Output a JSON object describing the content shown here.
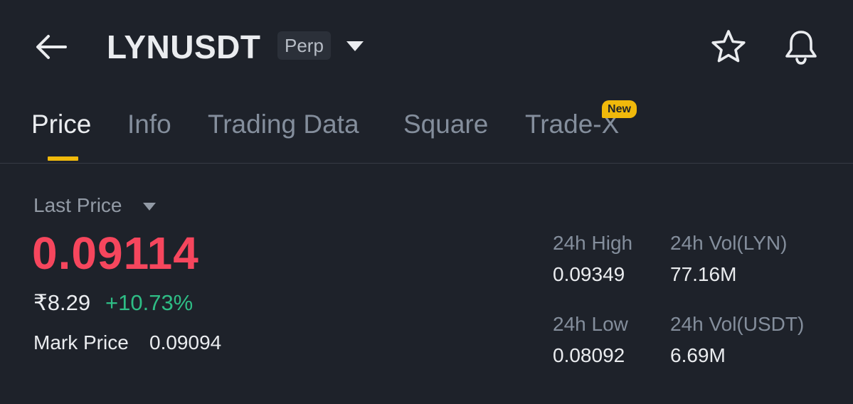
{
  "header": {
    "symbol": "LYNUSDT",
    "contract_type": "Perp"
  },
  "tabs": [
    {
      "label": "Price",
      "active": true
    },
    {
      "label": "Info",
      "active": false
    },
    {
      "label": "Trading Data",
      "active": false
    },
    {
      "label": "Square",
      "active": false
    },
    {
      "label": "Trade-X",
      "active": false,
      "badge": "New"
    }
  ],
  "price": {
    "label": "Last Price",
    "last_price": "0.09114",
    "fiat_value": "₹8.29",
    "change_percent": "+10.73%",
    "mark_price_label": "Mark Price",
    "mark_price": "0.09094"
  },
  "stats": {
    "high_label": "24h High",
    "high_value": "0.09349",
    "vol_base_label": "24h Vol(LYN)",
    "vol_base_value": "77.16M",
    "low_label": "24h Low",
    "low_value": "0.08092",
    "vol_quote_label": "24h Vol(USDT)",
    "vol_quote_value": "6.69M"
  },
  "colors": {
    "background": "#1e222a",
    "accent": "#f0b90b",
    "price_down_red": "#f6465d",
    "change_up_green": "#2ebd85"
  },
  "icons": {
    "back": "arrow-left-icon",
    "caret": "caret-down-icon",
    "favorite": "star-icon",
    "alerts": "bell-icon"
  }
}
